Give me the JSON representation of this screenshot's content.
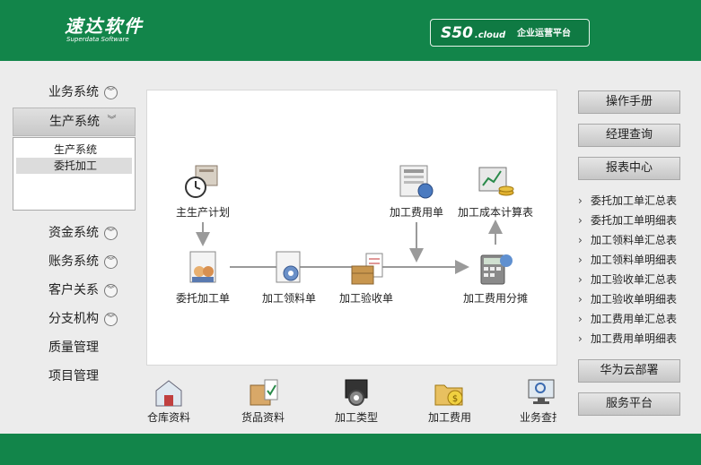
{
  "header": {
    "logo_text": "速达软件",
    "logo_subtext": "Superdata Software",
    "product_code": "S50",
    "product_suffix": ".cloud",
    "product_name": "企业运营平台"
  },
  "left_nav": {
    "items": [
      {
        "label": "业务系统",
        "icon": "chevron-circle-down-icon"
      },
      {
        "label": "生产系统",
        "icon": "chevron-down-icon"
      },
      {
        "label": "资金系统",
        "icon": "chevron-circle-down-icon"
      },
      {
        "label": "账务系统",
        "icon": "chevron-circle-down-icon"
      },
      {
        "label": "客户关系",
        "icon": "chevron-circle-down-icon"
      },
      {
        "label": "分支机构",
        "icon": "chevron-circle-down-icon"
      },
      {
        "label": "质量管理"
      },
      {
        "label": "项目管理"
      }
    ],
    "submenu": [
      {
        "label": "生产系统"
      },
      {
        "label": "委托加工"
      }
    ]
  },
  "flow": {
    "nodes": {
      "master_plan": {
        "label": "主生产计划",
        "icon": "production-plan-icon"
      },
      "outsourcing_order": {
        "label": "委托加工单",
        "icon": "outsourcing-order-icon"
      },
      "material_requisition": {
        "label": "加工领料单",
        "icon": "material-requisition-icon"
      },
      "acceptance_order": {
        "label": "加工验收单",
        "icon": "acceptance-order-icon"
      },
      "expense_order": {
        "label": "加工费用单",
        "icon": "expense-document-icon"
      },
      "expense_allocation": {
        "label": "加工费用分摊",
        "icon": "calculator-icon"
      },
      "cost_calc": {
        "label": "加工成本计算表",
        "icon": "cost-calculation-icon"
      }
    }
  },
  "bottom_shortcuts": [
    {
      "label": "仓库资料",
      "icon": "warehouse-icon"
    },
    {
      "label": "货品资料",
      "icon": "goods-box-icon"
    },
    {
      "label": "加工类型",
      "icon": "gear-screen-icon"
    },
    {
      "label": "加工费用",
      "icon": "money-folder-icon"
    },
    {
      "label": "业务查找",
      "icon": "monitor-search-icon"
    }
  ],
  "right_panel": {
    "manual_label": "操作手册",
    "manager_label": "经理查询",
    "report_center_label": "报表中心",
    "reports": [
      {
        "label": "委托加工单汇总表"
      },
      {
        "label": "委托加工单明细表"
      },
      {
        "label": "加工领料单汇总表"
      },
      {
        "label": "加工领料单明细表"
      },
      {
        "label": "加工验收单汇总表"
      },
      {
        "label": "加工验收单明细表"
      },
      {
        "label": "加工费用单汇总表"
      },
      {
        "label": "加工费用单明细表"
      }
    ],
    "huawei_label": "华为云部署",
    "service_label": "服务平台"
  },
  "colors": {
    "brand_green": "#12854a",
    "panel_border": "#a9a9a9",
    "arrow_gray": "#999999"
  }
}
